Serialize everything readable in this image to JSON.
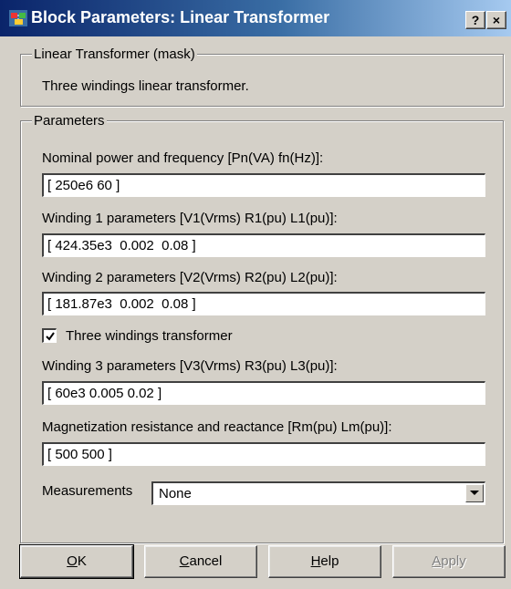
{
  "window": {
    "title": "Block Parameters: Linear Transformer",
    "help_glyph": "?",
    "close_glyph": "×",
    "icon": "simulink-block-icon"
  },
  "mask_group": {
    "legend": "Linear Transformer (mask)",
    "description": "Three windings linear transformer."
  },
  "params_group": {
    "legend": "Parameters",
    "nominal": {
      "label": "Nominal power and frequency [Pn(VA) fn(Hz)]:",
      "value": "[ 250e6 60 ]"
    },
    "winding1": {
      "label": "Winding 1 parameters [V1(Vrms) R1(pu) L1(pu)]:",
      "value": "[ 424.35e3  0.002  0.08 ]"
    },
    "winding2": {
      "label": "Winding 2 parameters [V2(Vrms) R2(pu) L2(pu)]:",
      "value": "[ 181.87e3  0.002  0.08 ]"
    },
    "three_windings": {
      "label": "Three windings transformer",
      "checked": true
    },
    "winding3": {
      "label": "Winding 3 parameters [V3(Vrms) R3(pu) L3(pu)]:",
      "value": "[ 60e3 0.005 0.02 ]"
    },
    "magnetization": {
      "label": "Magnetization resistance and reactance [Rm(pu) Lm(pu)]:",
      "value": "[ 500 500 ]"
    },
    "measurements": {
      "label": "Measurements",
      "selected": "None"
    }
  },
  "buttons": {
    "ok": {
      "mnemonic": "O",
      "rest": "K"
    },
    "cancel": {
      "mnemonic": "C",
      "rest": "ancel"
    },
    "help": {
      "mnemonic": "H",
      "rest": "elp"
    },
    "apply": {
      "mnemonic": "A",
      "rest": "pply",
      "disabled": true
    }
  },
  "colors": {
    "dialog_bg": "#d4d0c8",
    "title_gradient_start": "#0a246a",
    "title_gradient_end": "#a6caf0",
    "disabled_text": "#808080"
  }
}
